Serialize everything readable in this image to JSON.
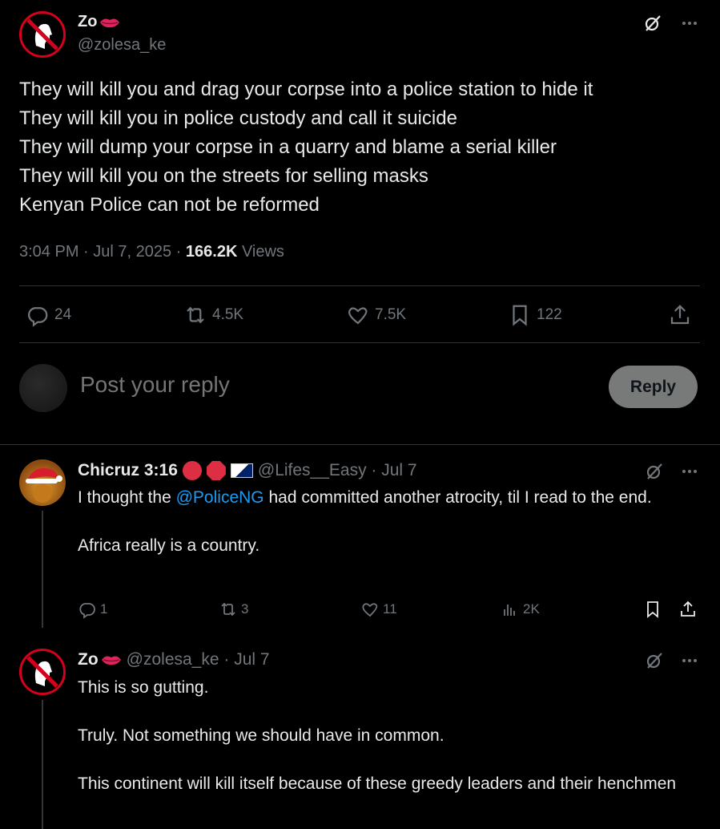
{
  "main_tweet": {
    "display_name": "Zo",
    "handle": "@zolesa_ke",
    "text": "They will kill you and drag your corpse into a police station to hide it\nThey will kill you in police custody and call it suicide\nThey will dump your corpse in a quarry and blame a serial killer\nThey will kill you on the streets for selling masks\nKenyan Police can not be reformed",
    "timestamp": "3:04 PM · Jul 7, 2025 · ",
    "views_count": "166.2K",
    "views_label": " Views",
    "actions": {
      "replies": "24",
      "reposts": "4.5K",
      "likes": "7.5K",
      "bookmarks": "122"
    }
  },
  "reply_box": {
    "placeholder": "Post your reply",
    "button_label": "Reply"
  },
  "replies": [
    {
      "display_name": "Chicruz 3:16",
      "handle_date": "@Lifes__Easy · Jul 7",
      "text_before_mention": "I thought the ",
      "mention": "@PoliceNG",
      "text_after_mention": " had committed another atrocity, til I read to the end.\n\nAfrica really is a country.",
      "actions": {
        "replies": "1",
        "reposts": "3",
        "likes": "11",
        "views": "2K"
      }
    },
    {
      "display_name": "Zo",
      "handle_date": "@zolesa_ke · Jul 7",
      "text": "This is so gutting.\n\nTruly. Not something we should have in common.\n\nThis continent will kill itself because of these greedy leaders and their henchmen"
    }
  ],
  "icons": {
    "grok": "grok-icon",
    "more": "more-icon",
    "reply": "reply-icon",
    "repost": "repost-icon",
    "like": "heart-icon",
    "bookmark": "bookmark-icon",
    "share": "share-icon",
    "views": "analytics-icon"
  },
  "colors": {
    "background": "#000000",
    "text": "#e7e9ea",
    "secondary": "#71767b",
    "link": "#1d9bf0",
    "divider": "#2f3336"
  }
}
